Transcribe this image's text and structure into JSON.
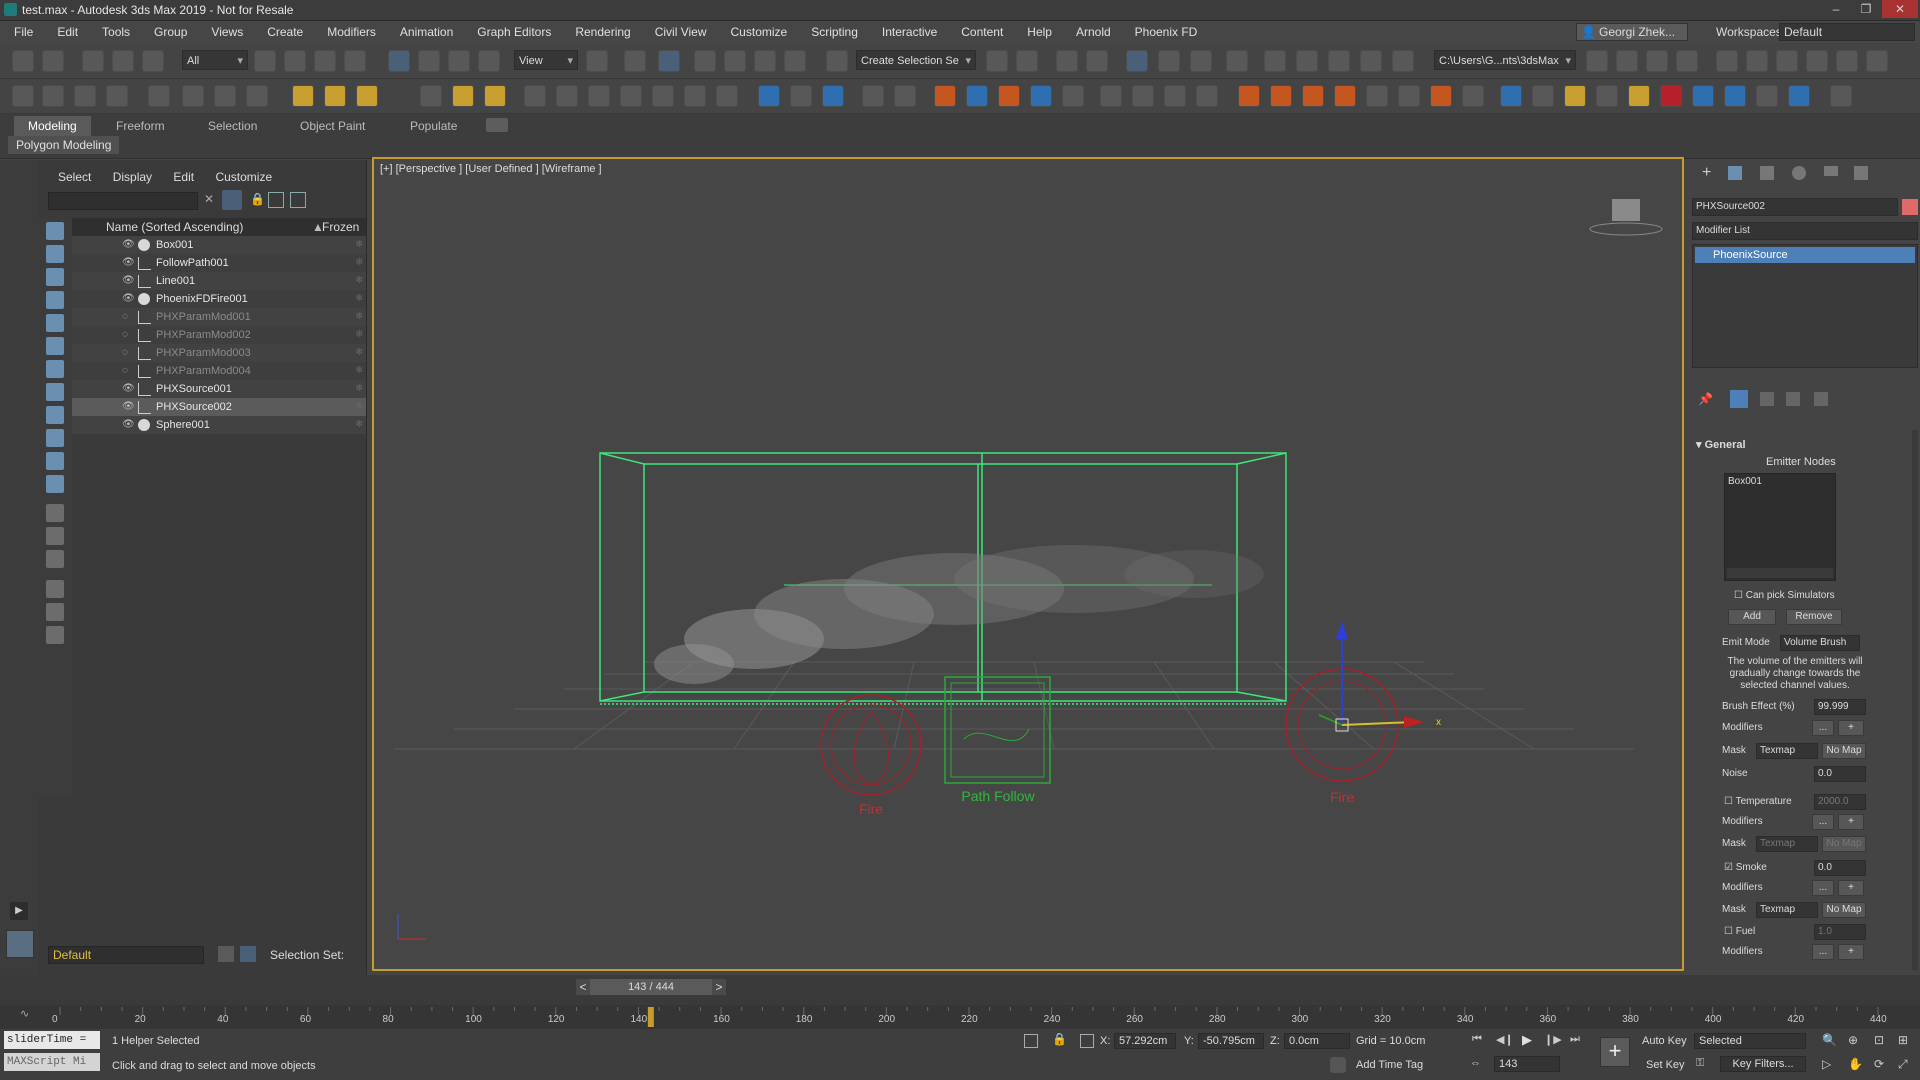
{
  "window": {
    "title": "test.max - Autodesk 3ds Max 2019 - Not for Resale"
  },
  "menu": [
    "File",
    "Edit",
    "Tools",
    "Group",
    "Views",
    "Create",
    "Modifiers",
    "Animation",
    "Graph Editors",
    "Rendering",
    "Civil View",
    "Customize",
    "Scripting",
    "Interactive",
    "Content",
    "Help",
    "Arnold",
    "Phoenix FD"
  ],
  "account": {
    "user": "Georgi Zhek...",
    "workspaces_label": "Workspaces:",
    "workspace": "Default"
  },
  "toolbar": {
    "filter": "All",
    "ref_coord": "View",
    "selection_set": "Create Selection Se",
    "path": "C:\\Users\\G...nts\\3dsMax"
  },
  "ribbon": {
    "tabs": [
      "Modeling",
      "Freeform",
      "Selection",
      "Object Paint",
      "Populate"
    ],
    "sub": "Polygon Modeling"
  },
  "scene_explorer": {
    "tabs": [
      "Select",
      "Display",
      "Edit",
      "Customize"
    ],
    "col_name": "Name (Sorted Ascending)",
    "col_frozen": "Frozen",
    "rows": [
      {
        "name": "Box001",
        "kind": "geo",
        "hidden": false,
        "selected": false
      },
      {
        "name": "FollowPath001",
        "kind": "helper",
        "hidden": false,
        "selected": false
      },
      {
        "name": "Line001",
        "kind": "shape",
        "hidden": false,
        "selected": false
      },
      {
        "name": "PhoenixFDFire001",
        "kind": "geo",
        "hidden": false,
        "selected": false
      },
      {
        "name": "PHXParamMod001",
        "kind": "helper",
        "hidden": true,
        "selected": false
      },
      {
        "name": "PHXParamMod002",
        "kind": "helper",
        "hidden": true,
        "selected": false
      },
      {
        "name": "PHXParamMod003",
        "kind": "helper",
        "hidden": true,
        "selected": false
      },
      {
        "name": "PHXParamMod004",
        "kind": "helper",
        "hidden": true,
        "selected": false
      },
      {
        "name": "PHXSource001",
        "kind": "helper",
        "hidden": false,
        "selected": false
      },
      {
        "name": "PHXSource002",
        "kind": "helper",
        "hidden": false,
        "selected": true
      },
      {
        "name": "Sphere001",
        "kind": "geo",
        "hidden": false,
        "selected": false
      }
    ],
    "layer": "Default",
    "selection_set_label": "Selection Set:"
  },
  "viewport": {
    "label": "[+] [Perspective ] [User Defined ] [Wireframe ]",
    "annotations": {
      "fire_left": "Fire",
      "path_follow": "Path Follow",
      "fire_right": "Fire"
    },
    "axis_x": "x"
  },
  "command_panel": {
    "object_name": "PHXSource002",
    "modifier_list": "Modifier List",
    "stack_item": "PhoenixSource",
    "rollout": "General",
    "emitter_nodes_label": "Emitter Nodes",
    "emitter_nodes": [
      "Box001"
    ],
    "can_pick": "Can pick Simulators",
    "add": "Add",
    "remove": "Remove",
    "emit_mode_label": "Emit Mode",
    "emit_mode": "Volume Brush",
    "emit_desc": "The volume of the emitters will gradually change towards the selected channel values.",
    "brush_effect_label": "Brush Effect (%)",
    "brush_effect": "99.999",
    "modifiers_label": "Modifiers",
    "dots": "...",
    "plus": "+",
    "mask_label": "Mask",
    "texmap": "Texmap",
    "no_map": "No Map",
    "noise_label": "Noise",
    "noise": "0.0",
    "temperature_label": "Temperature",
    "temperature": "2000.0",
    "smoke_label": "Smoke",
    "smoke": "0.0",
    "fuel_label": "Fuel",
    "fuel": "1.0"
  },
  "timeline": {
    "frame": "143 / 444",
    "prev": "<",
    "next": ">"
  },
  "trackbar": {
    "ticks": [
      "0",
      "20",
      "40",
      "60",
      "80",
      "100",
      "120",
      "140",
      "160",
      "180",
      "200",
      "220",
      "240",
      "260",
      "280",
      "300",
      "320",
      "340",
      "360",
      "380",
      "400",
      "420",
      "440"
    ],
    "current": 143,
    "total": 444
  },
  "status": {
    "script_line1": "sliderTime =",
    "script_line2": "MAXScript Mi",
    "selected": "1 Helper Selected",
    "hint": "Click and drag to select and move objects",
    "x_label": "X:",
    "x": "57.292cm",
    "y_label": "Y:",
    "y": "-50.795cm",
    "z_label": "Z:",
    "z": "0.0cm",
    "grid": "Grid = 10.0cm",
    "add_time_tag": "Add Time Tag",
    "auto_key": "Auto Key",
    "set_key": "Set Key",
    "key_mode": "Selected",
    "key_filters": "Key Filters...",
    "frame": "143"
  }
}
